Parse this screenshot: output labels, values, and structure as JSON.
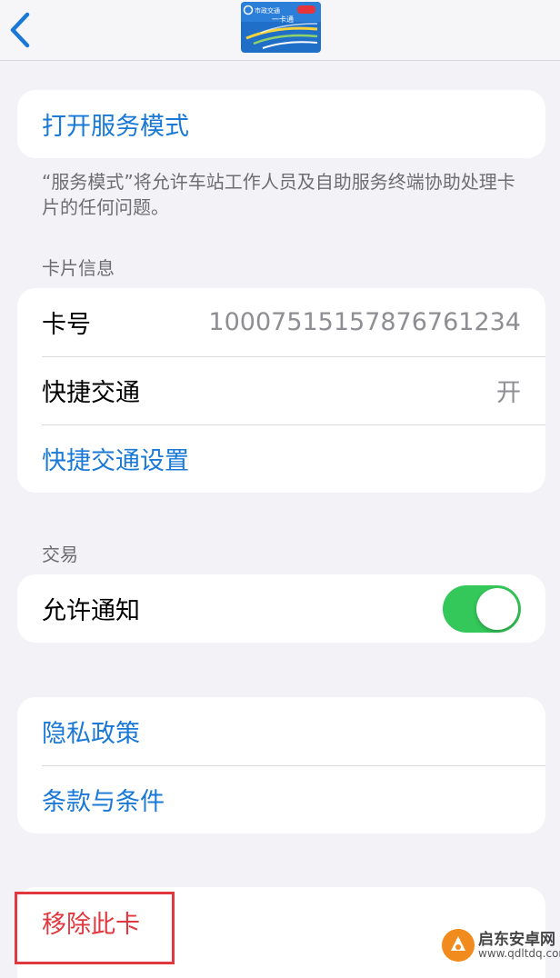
{
  "navbar": {
    "back_icon": "chevron-left-icon",
    "card_logo_text": "市政交通一卡通",
    "card_logo_brand": "一卡通"
  },
  "service": {
    "open_service_mode": "打开服务模式",
    "footnote": "“服务模式”将允许车站工作人员及自助服务终端协助处理卡片的任何问题。"
  },
  "card_info": {
    "header": "卡片信息",
    "card_number_label": "卡号",
    "card_number_value": "100075151578767612​34",
    "express_transit_label": "快捷交通",
    "express_transit_value": "开",
    "express_transit_settings": "快捷交通设置"
  },
  "transactions": {
    "header": "交易",
    "allow_notifications_label": "允许通知",
    "allow_notifications_on": true
  },
  "legal": {
    "privacy_policy": "隐私政策",
    "terms": "条款与条件"
  },
  "danger": {
    "remove_card": "移除此卡"
  },
  "watermark": {
    "title": "启东安卓网",
    "url": "www.qdltdq.com"
  },
  "colors": {
    "link_blue": "#1a79d6",
    "toggle_green": "#34c759",
    "destructive_red": "#e0383e",
    "background": "#f2f2f7"
  }
}
